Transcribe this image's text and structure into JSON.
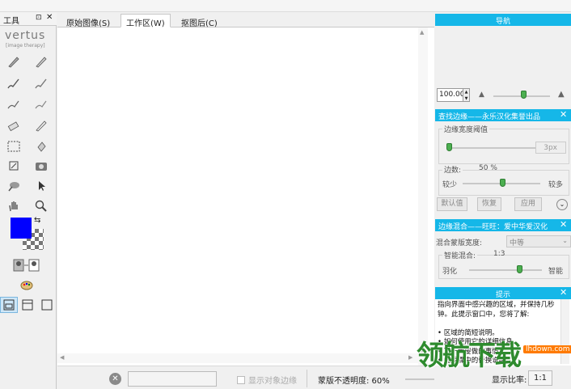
{
  "tools_panel": {
    "title": "工具",
    "pin": "⊡",
    "close": "✕",
    "logo": "vertus",
    "logo_sub": "[image therapy]"
  },
  "tabs": [
    {
      "label": "原始图像(S)",
      "active": false
    },
    {
      "label": "工作区(W)",
      "active": true
    },
    {
      "label": "抠图后(C)",
      "active": false
    }
  ],
  "colors": {
    "foreground": "#0000ff",
    "panel_header": "#15b7e8",
    "watermark": "#2e8b2e"
  },
  "status": {
    "show_edge_label": "显示对象边缘",
    "opacity_label": "蒙版不透明度: 60%",
    "ratio_label": "显示比率:",
    "ratio_button": "1:1"
  },
  "navigator": {
    "title": "导航",
    "zoom_value": "100.00"
  },
  "find_edge": {
    "title": "查找边缘——永乐汉化集誉出品",
    "width_group": "边缘宽度阈值",
    "width_value": "3px",
    "edge_label": "边数:",
    "edge_value": "50 %",
    "less_label": "较少",
    "more_label": "较多",
    "default_btn": "默认值",
    "restore_btn": "恢复",
    "apply_btn": "应用"
  },
  "edge_blend": {
    "title": "边缘混合——旺旺：爱中华爱汉化",
    "width_label": "混合蒙版宽度:",
    "width_option": "中等",
    "smart_label": "智能混合:",
    "smart_value": "1:3",
    "feather_label": "羽化",
    "smart_end": "智能"
  },
  "hint": {
    "title": "提示",
    "text": "指向界面中感兴趣的区域，并保持几秒钟。此提示窗口中，您将了解:\n\n• 区域的简短说明。\n• 如何使用它的详细信息。\n• 下一步要做的事情。\n• 此步骤中的替换说明。"
  },
  "watermark": {
    "text": "领航下载",
    "url": "lhdown.com"
  }
}
